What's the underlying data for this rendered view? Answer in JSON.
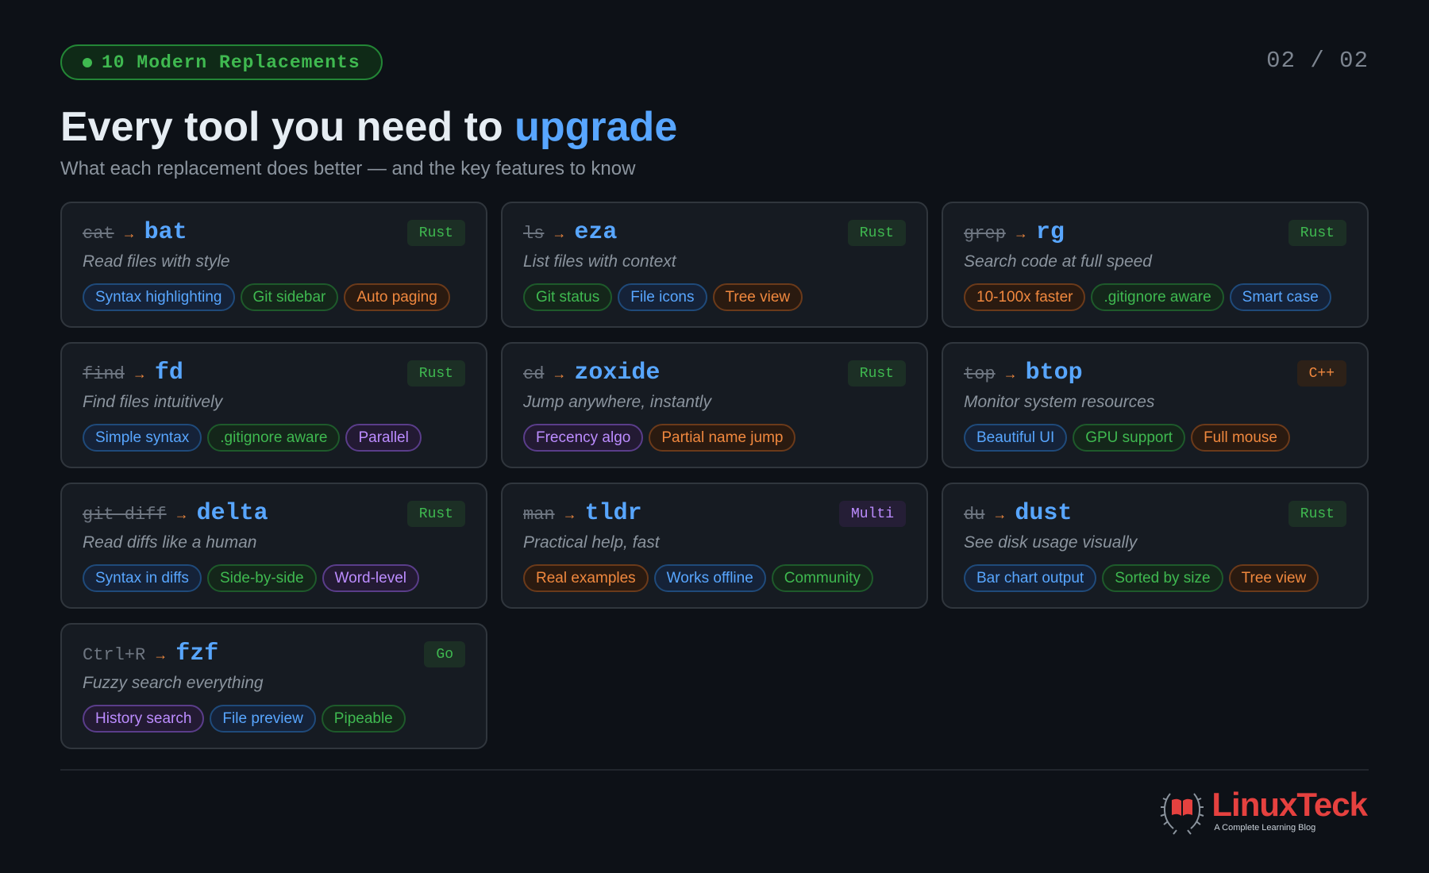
{
  "badge": {
    "label": "10 Modern Replacements"
  },
  "page_number": "02 / 02",
  "title": {
    "main": "Every tool you need to",
    "accent": "upgrade"
  },
  "subtitle": "What each replacement does better — and the key features to know",
  "colors": {
    "background": "#0d1117",
    "card": "#161b22",
    "accent_blue": "#58a6ff",
    "accent_green": "#3fb950",
    "accent_orange": "#f0883e",
    "accent_purple": "#bc8cff",
    "brand_red": "#e5413f"
  },
  "tools": [
    {
      "old": "cat",
      "arrow": "→",
      "new": "bat",
      "lang": "Rust",
      "desc": "Read files with style",
      "tags": [
        {
          "label": "Syntax highlighting",
          "color": "blue"
        },
        {
          "label": "Git sidebar",
          "color": "green"
        },
        {
          "label": "Auto paging",
          "color": "orange"
        }
      ]
    },
    {
      "old": "ls",
      "arrow": "→",
      "new": "eza",
      "lang": "Rust",
      "desc": "List files with context",
      "tags": [
        {
          "label": "Git status",
          "color": "green"
        },
        {
          "label": "File icons",
          "color": "blue"
        },
        {
          "label": "Tree view",
          "color": "orange"
        }
      ]
    },
    {
      "old": "grep",
      "arrow": "→",
      "new": "rg",
      "lang": "Rust",
      "desc": "Search code at full speed",
      "tags": [
        {
          "label": "10-100x faster",
          "color": "orange"
        },
        {
          "label": ".gitignore aware",
          "color": "green"
        },
        {
          "label": "Smart case",
          "color": "blue"
        }
      ]
    },
    {
      "old": "find",
      "arrow": "→",
      "new": "fd",
      "lang": "Rust",
      "desc": "Find files intuitively",
      "tags": [
        {
          "label": "Simple syntax",
          "color": "blue"
        },
        {
          "label": ".gitignore aware",
          "color": "green"
        },
        {
          "label": "Parallel",
          "color": "purple"
        }
      ]
    },
    {
      "old": "cd",
      "arrow": "→",
      "new": "zoxide",
      "lang": "Rust",
      "desc": "Jump anywhere, instantly",
      "tags": [
        {
          "label": "Frecency algo",
          "color": "purple"
        },
        {
          "label": "Partial name jump",
          "color": "orange"
        }
      ]
    },
    {
      "old": "top",
      "arrow": "→",
      "new": "btop",
      "lang": "C++",
      "desc": "Monitor system resources",
      "tags": [
        {
          "label": "Beautiful UI",
          "color": "blue"
        },
        {
          "label": "GPU support",
          "color": "green"
        },
        {
          "label": "Full mouse",
          "color": "orange"
        }
      ]
    },
    {
      "old": "git diff",
      "arrow": "→",
      "new": "delta",
      "lang": "Rust",
      "desc": "Read diffs like a human",
      "tags": [
        {
          "label": "Syntax in diffs",
          "color": "blue"
        },
        {
          "label": "Side-by-side",
          "color": "green"
        },
        {
          "label": "Word-level",
          "color": "purple"
        }
      ]
    },
    {
      "old": "man",
      "arrow": "→",
      "new": "tldr",
      "lang": "Multi",
      "desc": "Practical help, fast",
      "tags": [
        {
          "label": "Real examples",
          "color": "orange"
        },
        {
          "label": "Works offline",
          "color": "blue"
        },
        {
          "label": "Community",
          "color": "green"
        }
      ]
    },
    {
      "old": "du",
      "arrow": "→",
      "new": "dust",
      "lang": "Rust",
      "desc": "See disk usage visually",
      "tags": [
        {
          "label": "Bar chart output",
          "color": "blue"
        },
        {
          "label": "Sorted by size",
          "color": "green"
        },
        {
          "label": "Tree view",
          "color": "orange"
        }
      ]
    },
    {
      "old": "Ctrl+R",
      "arrow": "→",
      "new": "fzf",
      "lang": "Go",
      "desc": "Fuzzy search everything",
      "tags": [
        {
          "label": "History search",
          "color": "purple"
        },
        {
          "label": "File preview",
          "color": "blue"
        },
        {
          "label": "Pipeable",
          "color": "green"
        }
      ]
    }
  ],
  "footer": {
    "brand": "LinuxTeck",
    "tagline": "A Complete Learning Blog",
    "logo_icon": "book-laurel-icon"
  }
}
